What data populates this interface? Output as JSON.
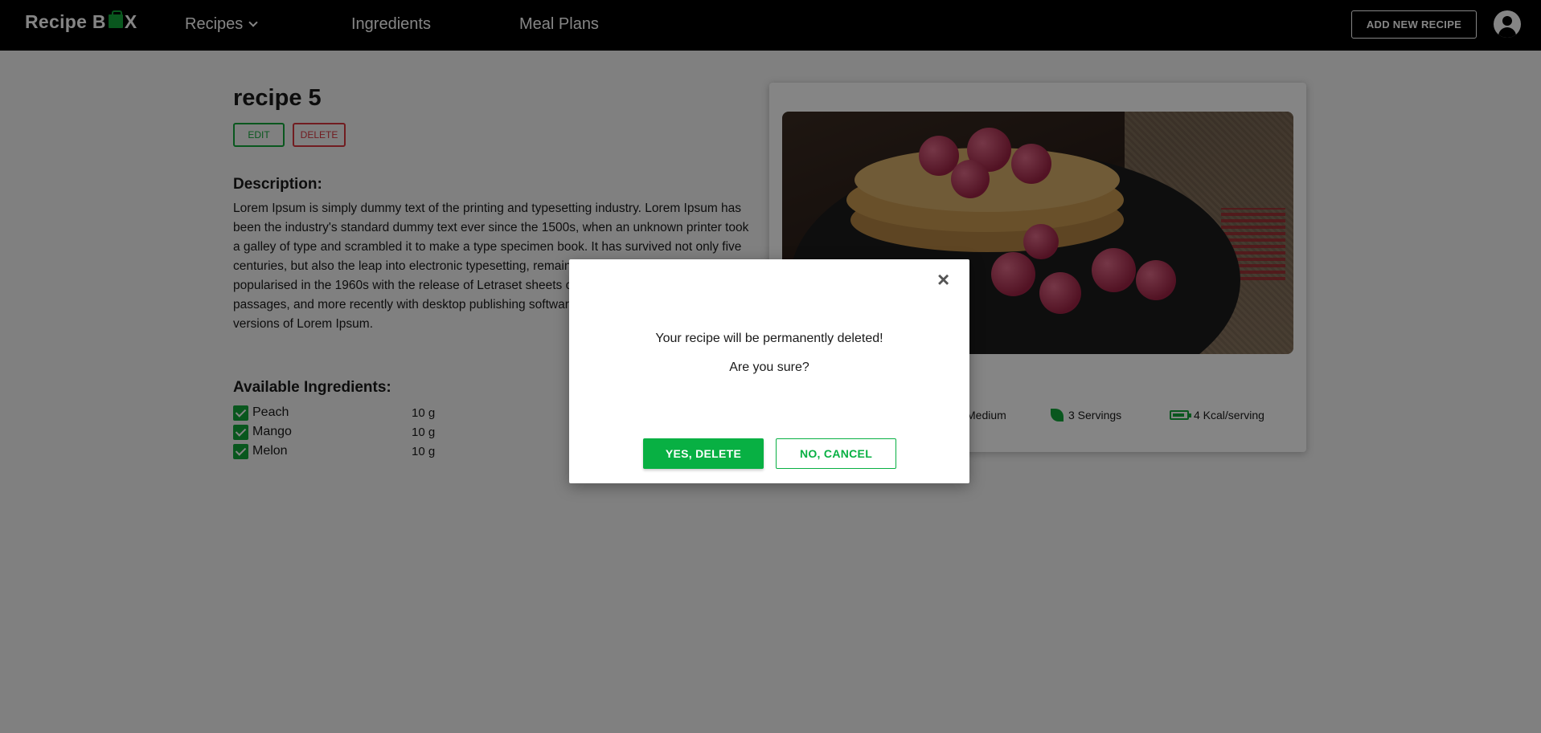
{
  "navbar": {
    "logo_prefix": "Recipe B",
    "logo_suffix": "X",
    "links": [
      "Recipes",
      "Ingredients",
      "Meal Plans"
    ],
    "add_button": "ADD NEW RECIPE"
  },
  "recipe": {
    "title": "recipe 5",
    "edit_label": "EDIT",
    "delete_label": "DELETE",
    "description_heading": "Description:",
    "description": "Lorem Ipsum is simply dummy text of the printing and typesetting industry. Lorem Ipsum has been the industry's standard dummy text ever since the 1500s, when an unknown printer took a galley of type and scrambled it to make a type specimen book. It has survived not only five centuries, but also the leap into electronic typesetting, remaining essentially unchanged. It was popularised in the 1960s with the release of Letraset sheets containing Lorem Ipsum passages, and more recently with desktop publishing software like Aldus PageMaker including versions of Lorem Ipsum.",
    "ingredients_heading": "Available Ingredients:",
    "ingredients": [
      {
        "name": "Peach",
        "qty": "10 g"
      },
      {
        "name": "Mango",
        "qty": "10 g"
      },
      {
        "name": "Melon",
        "qty": "10 g"
      }
    ],
    "stats": {
      "difficulty": "Medium",
      "servings": "3 Servings",
      "calories": "4 Kcal/serving"
    }
  },
  "modal": {
    "close": "×",
    "message": "Your recipe will be permanently deleted!",
    "question": "Are you sure?",
    "confirm": "YES, DELETE",
    "cancel": "NO, CANCEL"
  },
  "colors": {
    "accent": "#08b043",
    "danger": "#d9363e",
    "navbar": "#000000"
  }
}
